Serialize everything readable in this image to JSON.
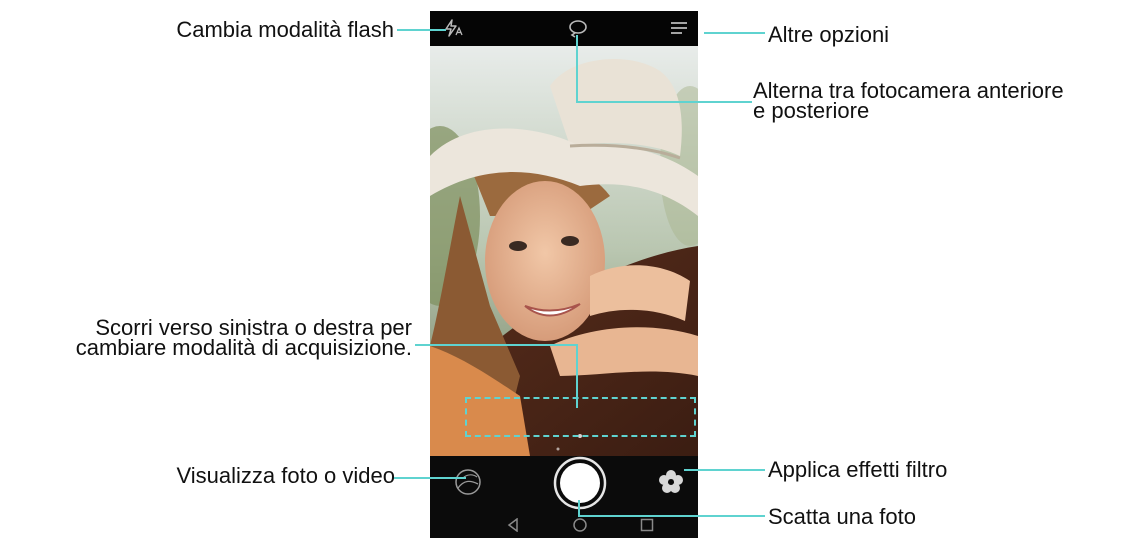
{
  "annotations": {
    "flash_mode": "Cambia modalità flash",
    "more_options": "Altre opzioni",
    "switch_camera_line1": "Alterna tra fotocamera anteriore",
    "switch_camera_line2": "e posteriore",
    "swipe_modes_line1": "Scorri verso sinistra o destra per",
    "swipe_modes_line2": "cambiare modalità di acquisizione.",
    "view_gallery": "Visualizza foto o video",
    "apply_filters": "Applica effetti filtro",
    "take_photo": "Scatta una foto"
  },
  "colors": {
    "callout_line": "#5fd3d0",
    "label_text": "#111111",
    "phone_bar": "#0b0b0b",
    "icon_gray": "#9a9a9a"
  },
  "icons": {
    "top_left": "flash-auto-icon",
    "top_center": "switch-camera-icon",
    "top_right": "menu-icon",
    "bottom_left": "gallery-icon",
    "bottom_center": "shutter-button",
    "bottom_right": "filter-icon",
    "nav_back": "nav-back-icon",
    "nav_home": "nav-home-icon",
    "nav_recent": "nav-recent-icon"
  }
}
